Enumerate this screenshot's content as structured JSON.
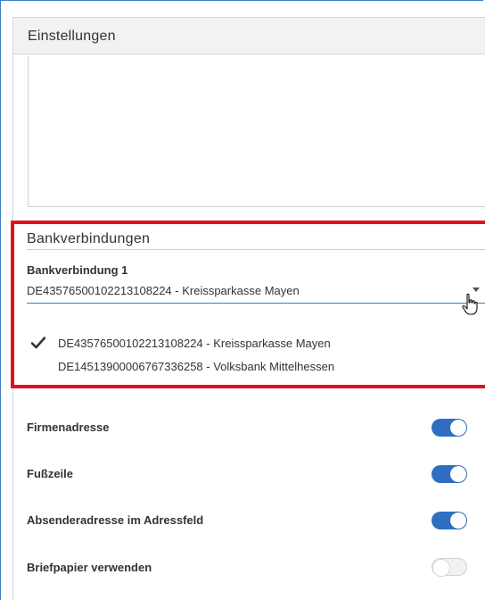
{
  "panel": {
    "title": "Einstellungen"
  },
  "bank_section": {
    "title": "Bankverbindungen",
    "field_label": "Bankverbindung 1",
    "selected_value": "DE43576500102213108224 - Kreissparkasse Mayen",
    "options": [
      {
        "label": "DE43576500102213108224 - Kreissparkasse Mayen",
        "selected": true
      },
      {
        "label": "DE14513900006767336258 - Volksbank Mittelhessen",
        "selected": false
      }
    ]
  },
  "toggles": [
    {
      "label": "Firmenadresse",
      "on": true
    },
    {
      "label": "Fußzeile",
      "on": true
    },
    {
      "label": "Absenderadresse im Adressfeld",
      "on": true
    },
    {
      "label": "Briefpapier verwenden",
      "on": false
    }
  ],
  "colors": {
    "accent": "#2e6fc1",
    "highlight": "#e3101c"
  },
  "icons": {
    "check": "check-icon",
    "caret": "chevron-down-icon",
    "cursor": "hand-pointer-icon"
  }
}
